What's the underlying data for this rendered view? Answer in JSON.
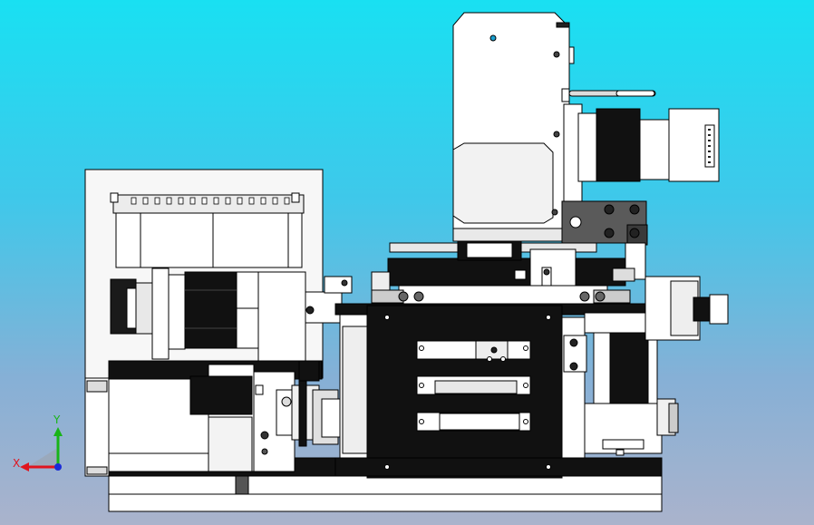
{
  "viewport": {
    "background_top": "#19e0f2",
    "background_bottom": "#aab3cc"
  },
  "model": {
    "edge_color": "#000000",
    "face_color": "#ffffff",
    "shade_color": "#e6e6e6",
    "dark_color": "#111111"
  },
  "triad": {
    "x_label": "X",
    "y_label": "Y",
    "x_color": "#e0141e",
    "y_color": "#18b418",
    "z_color": "#1a2bd8"
  }
}
